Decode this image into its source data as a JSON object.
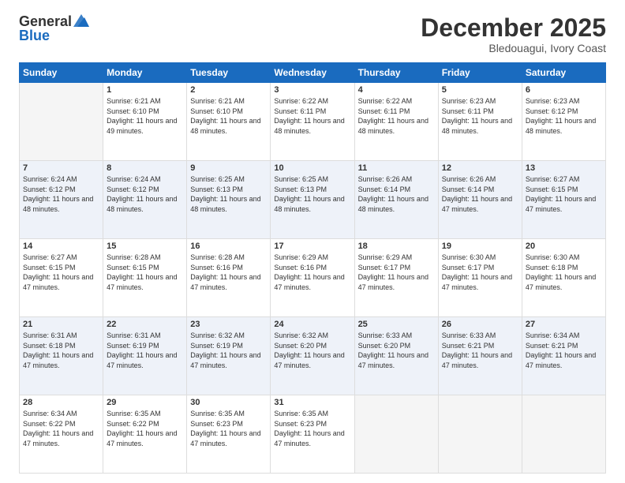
{
  "logo": {
    "general": "General",
    "blue": "Blue"
  },
  "title": "December 2025",
  "location": "Bledouagui, Ivory Coast",
  "days_of_week": [
    "Sunday",
    "Monday",
    "Tuesday",
    "Wednesday",
    "Thursday",
    "Friday",
    "Saturday"
  ],
  "weeks": [
    [
      {
        "day": "",
        "sunrise": "",
        "sunset": "",
        "daylight": "",
        "empty": true
      },
      {
        "day": "1",
        "sunrise": "Sunrise: 6:21 AM",
        "sunset": "Sunset: 6:10 PM",
        "daylight": "Daylight: 11 hours and 49 minutes."
      },
      {
        "day": "2",
        "sunrise": "Sunrise: 6:21 AM",
        "sunset": "Sunset: 6:10 PM",
        "daylight": "Daylight: 11 hours and 48 minutes."
      },
      {
        "day": "3",
        "sunrise": "Sunrise: 6:22 AM",
        "sunset": "Sunset: 6:11 PM",
        "daylight": "Daylight: 11 hours and 48 minutes."
      },
      {
        "day": "4",
        "sunrise": "Sunrise: 6:22 AM",
        "sunset": "Sunset: 6:11 PM",
        "daylight": "Daylight: 11 hours and 48 minutes."
      },
      {
        "day": "5",
        "sunrise": "Sunrise: 6:23 AM",
        "sunset": "Sunset: 6:11 PM",
        "daylight": "Daylight: 11 hours and 48 minutes."
      },
      {
        "day": "6",
        "sunrise": "Sunrise: 6:23 AM",
        "sunset": "Sunset: 6:12 PM",
        "daylight": "Daylight: 11 hours and 48 minutes."
      }
    ],
    [
      {
        "day": "7",
        "sunrise": "Sunrise: 6:24 AM",
        "sunset": "Sunset: 6:12 PM",
        "daylight": "Daylight: 11 hours and 48 minutes."
      },
      {
        "day": "8",
        "sunrise": "Sunrise: 6:24 AM",
        "sunset": "Sunset: 6:12 PM",
        "daylight": "Daylight: 11 hours and 48 minutes."
      },
      {
        "day": "9",
        "sunrise": "Sunrise: 6:25 AM",
        "sunset": "Sunset: 6:13 PM",
        "daylight": "Daylight: 11 hours and 48 minutes."
      },
      {
        "day": "10",
        "sunrise": "Sunrise: 6:25 AM",
        "sunset": "Sunset: 6:13 PM",
        "daylight": "Daylight: 11 hours and 48 minutes."
      },
      {
        "day": "11",
        "sunrise": "Sunrise: 6:26 AM",
        "sunset": "Sunset: 6:14 PM",
        "daylight": "Daylight: 11 hours and 48 minutes."
      },
      {
        "day": "12",
        "sunrise": "Sunrise: 6:26 AM",
        "sunset": "Sunset: 6:14 PM",
        "daylight": "Daylight: 11 hours and 47 minutes."
      },
      {
        "day": "13",
        "sunrise": "Sunrise: 6:27 AM",
        "sunset": "Sunset: 6:15 PM",
        "daylight": "Daylight: 11 hours and 47 minutes."
      }
    ],
    [
      {
        "day": "14",
        "sunrise": "Sunrise: 6:27 AM",
        "sunset": "Sunset: 6:15 PM",
        "daylight": "Daylight: 11 hours and 47 minutes."
      },
      {
        "day": "15",
        "sunrise": "Sunrise: 6:28 AM",
        "sunset": "Sunset: 6:15 PM",
        "daylight": "Daylight: 11 hours and 47 minutes."
      },
      {
        "day": "16",
        "sunrise": "Sunrise: 6:28 AM",
        "sunset": "Sunset: 6:16 PM",
        "daylight": "Daylight: 11 hours and 47 minutes."
      },
      {
        "day": "17",
        "sunrise": "Sunrise: 6:29 AM",
        "sunset": "Sunset: 6:16 PM",
        "daylight": "Daylight: 11 hours and 47 minutes."
      },
      {
        "day": "18",
        "sunrise": "Sunrise: 6:29 AM",
        "sunset": "Sunset: 6:17 PM",
        "daylight": "Daylight: 11 hours and 47 minutes."
      },
      {
        "day": "19",
        "sunrise": "Sunrise: 6:30 AM",
        "sunset": "Sunset: 6:17 PM",
        "daylight": "Daylight: 11 hours and 47 minutes."
      },
      {
        "day": "20",
        "sunrise": "Sunrise: 6:30 AM",
        "sunset": "Sunset: 6:18 PM",
        "daylight": "Daylight: 11 hours and 47 minutes."
      }
    ],
    [
      {
        "day": "21",
        "sunrise": "Sunrise: 6:31 AM",
        "sunset": "Sunset: 6:18 PM",
        "daylight": "Daylight: 11 hours and 47 minutes."
      },
      {
        "day": "22",
        "sunrise": "Sunrise: 6:31 AM",
        "sunset": "Sunset: 6:19 PM",
        "daylight": "Daylight: 11 hours and 47 minutes."
      },
      {
        "day": "23",
        "sunrise": "Sunrise: 6:32 AM",
        "sunset": "Sunset: 6:19 PM",
        "daylight": "Daylight: 11 hours and 47 minutes."
      },
      {
        "day": "24",
        "sunrise": "Sunrise: 6:32 AM",
        "sunset": "Sunset: 6:20 PM",
        "daylight": "Daylight: 11 hours and 47 minutes."
      },
      {
        "day": "25",
        "sunrise": "Sunrise: 6:33 AM",
        "sunset": "Sunset: 6:20 PM",
        "daylight": "Daylight: 11 hours and 47 minutes."
      },
      {
        "day": "26",
        "sunrise": "Sunrise: 6:33 AM",
        "sunset": "Sunset: 6:21 PM",
        "daylight": "Daylight: 11 hours and 47 minutes."
      },
      {
        "day": "27",
        "sunrise": "Sunrise: 6:34 AM",
        "sunset": "Sunset: 6:21 PM",
        "daylight": "Daylight: 11 hours and 47 minutes."
      }
    ],
    [
      {
        "day": "28",
        "sunrise": "Sunrise: 6:34 AM",
        "sunset": "Sunset: 6:22 PM",
        "daylight": "Daylight: 11 hours and 47 minutes."
      },
      {
        "day": "29",
        "sunrise": "Sunrise: 6:35 AM",
        "sunset": "Sunset: 6:22 PM",
        "daylight": "Daylight: 11 hours and 47 minutes."
      },
      {
        "day": "30",
        "sunrise": "Sunrise: 6:35 AM",
        "sunset": "Sunset: 6:23 PM",
        "daylight": "Daylight: 11 hours and 47 minutes."
      },
      {
        "day": "31",
        "sunrise": "Sunrise: 6:35 AM",
        "sunset": "Sunset: 6:23 PM",
        "daylight": "Daylight: 11 hours and 47 minutes."
      },
      {
        "day": "",
        "sunrise": "",
        "sunset": "",
        "daylight": "",
        "empty": true
      },
      {
        "day": "",
        "sunrise": "",
        "sunset": "",
        "daylight": "",
        "empty": true
      },
      {
        "day": "",
        "sunrise": "",
        "sunset": "",
        "daylight": "",
        "empty": true
      }
    ]
  ],
  "row_shades": [
    "white",
    "shade",
    "white",
    "shade",
    "white"
  ]
}
